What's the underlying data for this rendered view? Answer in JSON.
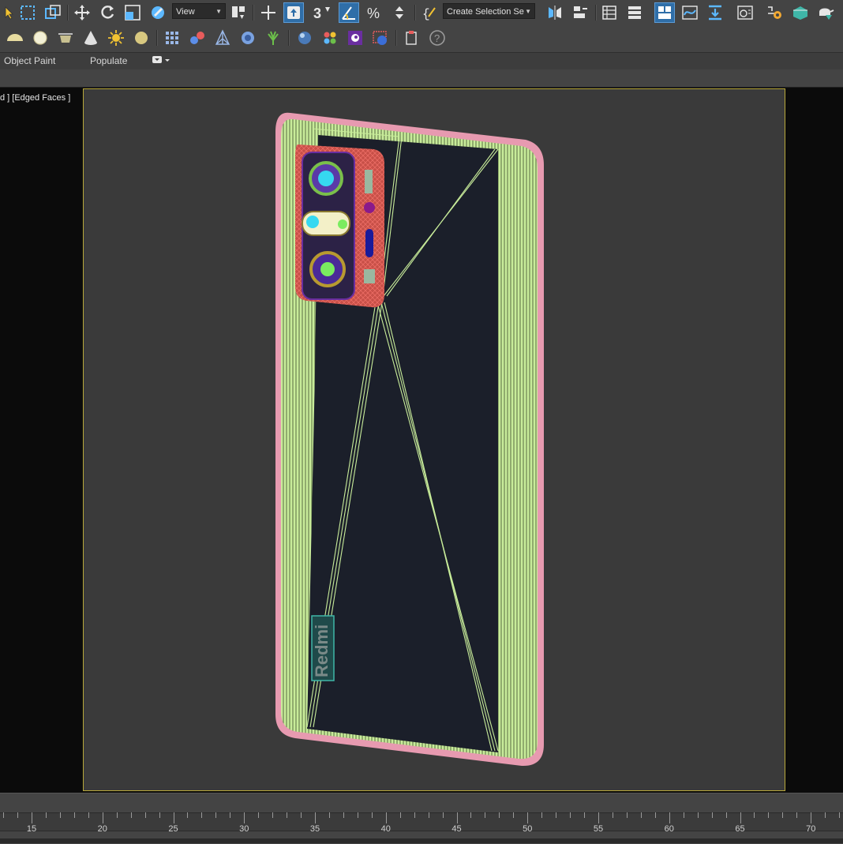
{
  "toolbar": {
    "view_dropdown": "View",
    "selection_set_dropdown": "Create Selection Se"
  },
  "ribbon": {
    "object_paint": "Object Paint",
    "populate": "Populate"
  },
  "viewport": {
    "label": "d ] [Edged Faces ]",
    "logo_text": "Redmi"
  },
  "timeline": {
    "labels": [
      "15",
      "20",
      "25",
      "30",
      "35",
      "40",
      "45",
      "50",
      "55",
      "60",
      "65",
      "70"
    ]
  },
  "colors": {
    "accent": "#2f6ea8",
    "safe_frame": "#b8a83a",
    "wire_green": "#c8ec9a",
    "wire_pink": "#e79ab0",
    "wire_red": "#e0645c",
    "phone_body": "#1b1f2a"
  }
}
